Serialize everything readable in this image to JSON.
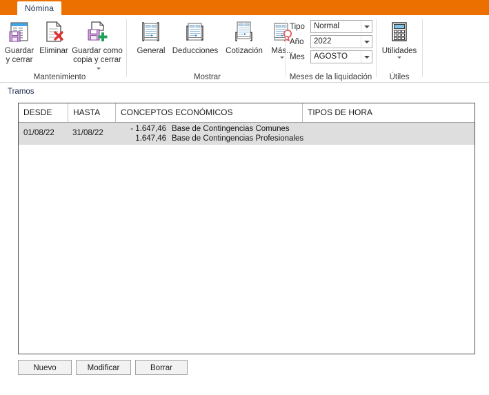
{
  "window": {
    "accent_color": "#ec7000",
    "tab_label": "Nómina"
  },
  "ribbon": {
    "groups": [
      {
        "title": "Mantenimiento",
        "buttons": [
          {
            "label_line1": "Guardar",
            "label_line2": "y cerrar",
            "icon": "save-close-icon",
            "has_caret": false
          },
          {
            "label_line1": "Eliminar",
            "label_line2": "",
            "icon": "delete-document-icon",
            "has_caret": false
          },
          {
            "label_line1": "Guardar como",
            "label_line2": "copia y cerrar",
            "icon": "save-copy-icon",
            "has_caret": true
          }
        ]
      },
      {
        "title": "Mostrar",
        "buttons": [
          {
            "label_line1": "General",
            "label_line2": "",
            "icon": "payslip-general-icon",
            "has_caret": false
          },
          {
            "label_line1": "Deducciones",
            "label_line2": "",
            "icon": "payslip-deductions-icon",
            "has_caret": false
          },
          {
            "label_line1": "Cotización",
            "label_line2": "",
            "icon": "payslip-contributions-icon",
            "has_caret": false
          },
          {
            "label_line1": "Más...",
            "label_line2": "",
            "icon": "payslip-more-icon",
            "has_caret": true
          }
        ]
      },
      {
        "title": "Meses de la liquidación",
        "fields": [
          {
            "label": "Tipo",
            "value": "Normal"
          },
          {
            "label": "Año",
            "value": "2022"
          },
          {
            "label": "Mes",
            "value": "AGOSTO"
          }
        ]
      },
      {
        "title": "Útiles",
        "buttons": [
          {
            "label_line1": "Utilidades",
            "label_line2": "",
            "icon": "calculator-icon",
            "has_caret": true
          }
        ]
      }
    ]
  },
  "main": {
    "section_label": "Tramos",
    "grid": {
      "columns": [
        {
          "key": "desde",
          "label": "DESDE"
        },
        {
          "key": "hasta",
          "label": "HASTA"
        },
        {
          "key": "conceptos",
          "label": "CONCEPTOS ECONÓMICOS"
        },
        {
          "key": "tipos",
          "label": "TIPOS DE HORA"
        }
      ],
      "rows": [
        {
          "selected": true,
          "desde": "01/08/22",
          "hasta": "31/08/22",
          "conceptos": [
            {
              "amount": "- 1.647,46",
              "name": "Base de Contingencias Comunes"
            },
            {
              "amount": "1.647,46",
              "name": "Base de Contingencias Profesionales"
            }
          ],
          "tipos": ""
        }
      ]
    },
    "buttons": [
      {
        "label": "Nuevo"
      },
      {
        "label": "Modificar"
      },
      {
        "label": "Borrar"
      }
    ]
  }
}
